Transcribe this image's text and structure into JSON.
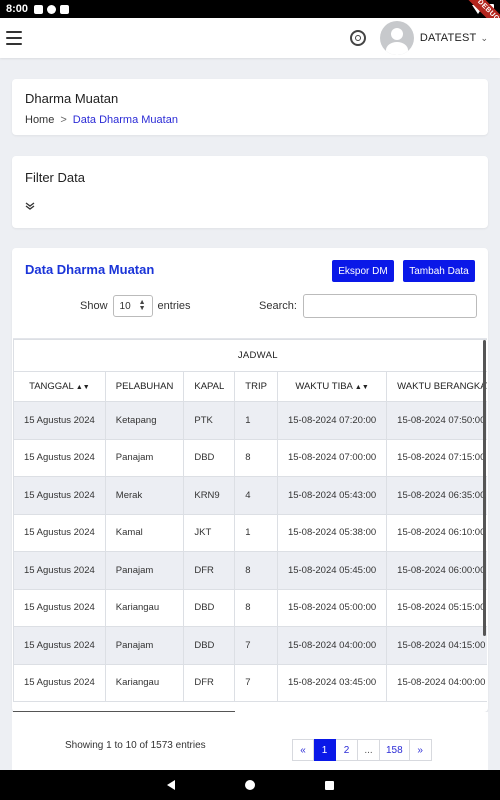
{
  "status_bar": {
    "time": "8:00",
    "debug_label": "DEBUG"
  },
  "header": {
    "username": "DATATEST",
    "chevron": "⌄"
  },
  "breadcrumb_card": {
    "title": "Dharma Muatan",
    "home": "Home",
    "separator": ">",
    "current": "Data Dharma Muatan"
  },
  "filter_card": {
    "title": "Filter Data"
  },
  "data_card": {
    "title": "Data Dharma Muatan",
    "export_button": "Ekspor DM",
    "add_button": "Tambah Data",
    "show_label": "Show",
    "entries_value": "10",
    "entries_label": "entries",
    "search_label": "Search:",
    "search_value": ""
  },
  "table": {
    "group_header": "JADWAL",
    "columns": [
      "TANGGAL",
      "PELABUHAN",
      "KAPAL",
      "TRIP",
      "WAKTU TIBA",
      "WAKTU BERANGKAT"
    ],
    "rows": [
      [
        "15 Agustus 2024",
        "Ketapang",
        "PTK",
        "1",
        "15-08-2024 07:20:00",
        "15-08-2024 07:50:00"
      ],
      [
        "15 Agustus 2024",
        "Panajam",
        "DBD",
        "8",
        "15-08-2024 07:00:00",
        "15-08-2024 07:15:00"
      ],
      [
        "15 Agustus 2024",
        "Merak",
        "KRN9",
        "4",
        "15-08-2024 05:43:00",
        "15-08-2024 06:35:00"
      ],
      [
        "15 Agustus 2024",
        "Kamal",
        "JKT",
        "1",
        "15-08-2024 05:38:00",
        "15-08-2024 06:10:00"
      ],
      [
        "15 Agustus 2024",
        "Panajam",
        "DFR",
        "8",
        "15-08-2024 05:45:00",
        "15-08-2024 06:00:00"
      ],
      [
        "15 Agustus 2024",
        "Kariangau",
        "DBD",
        "8",
        "15-08-2024 05:00:00",
        "15-08-2024 05:15:00"
      ],
      [
        "15 Agustus 2024",
        "Panajam",
        "DBD",
        "7",
        "15-08-2024 04:00:00",
        "15-08-2024 04:15:00"
      ],
      [
        "15 Agustus 2024",
        "Kariangau",
        "DFR",
        "7",
        "15-08-2024 03:45:00",
        "15-08-2024 04:00:00"
      ]
    ]
  },
  "pagination": {
    "info": "Showing 1 to 10 of 1573 entries",
    "prev": "«",
    "pages": [
      "1",
      "2",
      "...",
      "158"
    ],
    "active_page": "1",
    "next": "»"
  },
  "colors": {
    "accent": "#0a18e8",
    "title_blue": "#1a34d8",
    "row_stripe": "#eceef3",
    "background": "#edeff3"
  }
}
